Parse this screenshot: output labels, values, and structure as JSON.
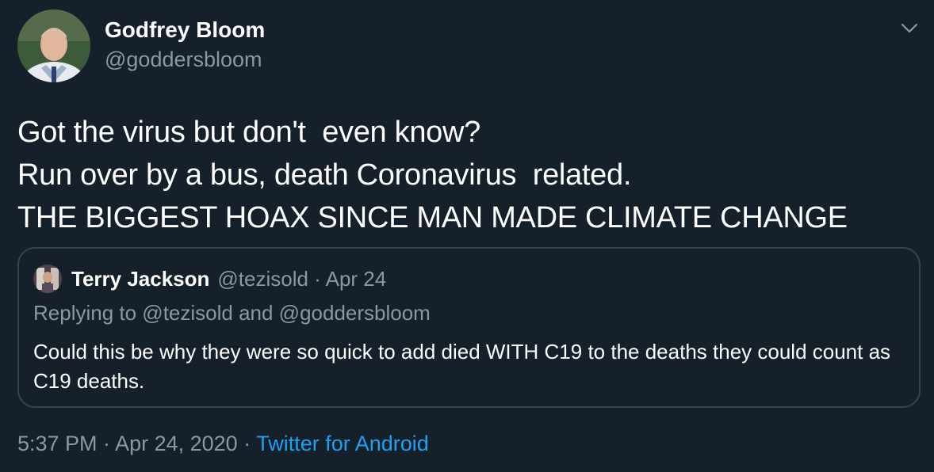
{
  "author": {
    "name": "Godfrey Bloom",
    "handle": "@goddersbloom"
  },
  "tweet": {
    "lines": [
      "Got the virus but don't  even know?",
      "Run over by a bus, death Coronavirus  related.",
      "THE BIGGEST HOAX SINCE MAN MADE CLIMATE CHANGE"
    ]
  },
  "quoted_tweet": {
    "name": "Terry Jackson",
    "meta": "@tezisold · Apr 24",
    "replying_to": "Replying to @tezisold and @goddersbloom",
    "text": "Could this be why they were so quick to add died WITH C19 to the deaths they could count as C19 deaths."
  },
  "footer": {
    "timestamp": "5:37 PM · Apr 24, 2020 · ",
    "source": "Twitter for Android"
  },
  "icons": {
    "menu": "chevron-down-icon"
  },
  "colors": {
    "background": "#15202b",
    "secondary_text": "#8899a6",
    "link": "#1da1f2",
    "border": "#38444d"
  }
}
